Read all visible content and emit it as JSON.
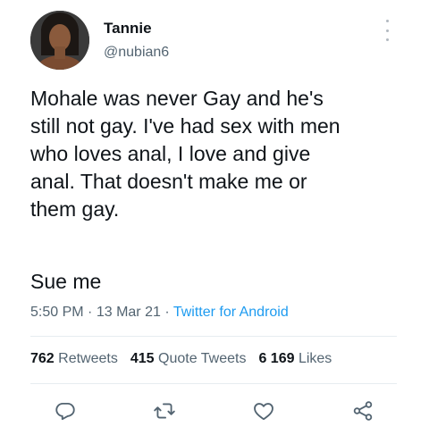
{
  "user": {
    "name": "Tannie",
    "handle": "@nubian6"
  },
  "tweet": {
    "lines": [
      "Mohale was never Gay and he's",
      "still not gay. I've had sex with men",
      "who loves anal, I love and give",
      "anal. That doesn't make me or",
      "them gay."
    ],
    "last_line": "Sue me"
  },
  "meta": {
    "time": "5:50 PM",
    "separator": "·",
    "date": "13 Mar 21",
    "source": "Twitter for Android"
  },
  "stats": {
    "retweets_count": "762",
    "retweets_label": "Retweets",
    "quotes_count": "415",
    "quotes_label": "Quote Tweets",
    "likes_count": "6 169",
    "likes_label": "Likes"
  },
  "actions": [
    "reply-icon",
    "retweet-icon",
    "like-icon",
    "share-icon"
  ],
  "colors": {
    "text": "#0f1419",
    "secondary": "#536471",
    "link": "#1d9bf0"
  }
}
